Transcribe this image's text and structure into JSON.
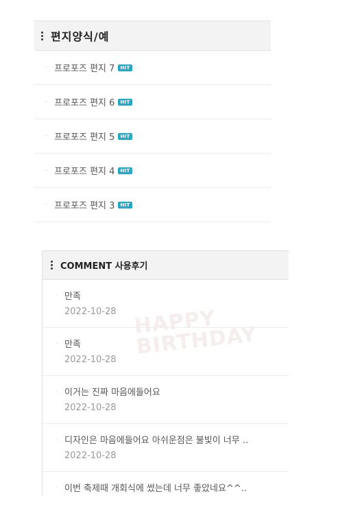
{
  "letters": {
    "title": "편지양식/예",
    "items": [
      {
        "label": "프로포즈 편지 7",
        "badge": "HIT"
      },
      {
        "label": "프로포즈 편지 6",
        "badge": "HIT"
      },
      {
        "label": "프로포즈 편지 5",
        "badge": "HIT"
      },
      {
        "label": "프로포즈 편지 4",
        "badge": "HIT"
      },
      {
        "label": "프로포즈 편지 3",
        "badge": "HIT"
      }
    ]
  },
  "comments": {
    "title": "COMMENT 사용후기",
    "watermark": "HAPPY BIRTHDAY",
    "items": [
      {
        "text": "만족",
        "date": "2022-10-28"
      },
      {
        "text": "만족",
        "date": "2022-10-28"
      },
      {
        "text": "이거는 진짜 마음에들어요",
        "date": "2022-10-28"
      },
      {
        "text": "디자인은 마음에들어요 아쉬운점은 불빛이 너무 ..",
        "date": "2022-10-28"
      },
      {
        "text": "이번 축제때 개회식에 썼는데 너무 좋았네요^^..",
        "date": ""
      }
    ]
  },
  "colors": {
    "hit_badge": "#25a9c9",
    "header_bg": "#f3f3f3"
  },
  "icons": {
    "header": "kebab-icon",
    "bullet": "dot-bullet-icon"
  }
}
